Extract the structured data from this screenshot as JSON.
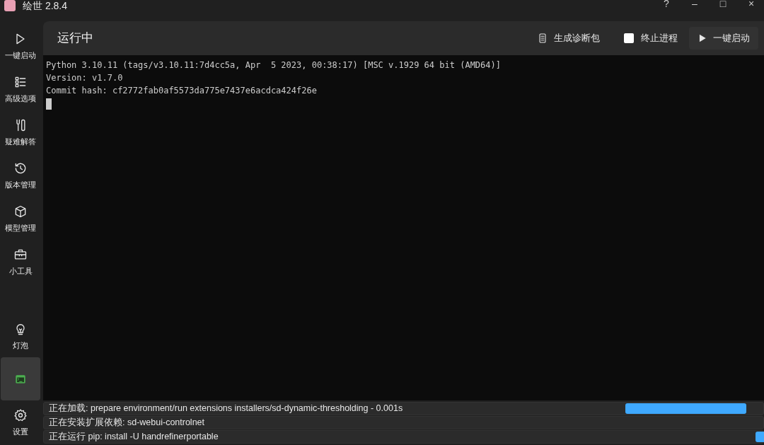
{
  "window": {
    "title": "绘世 2.8.4",
    "controls": [
      "?",
      "–",
      "□",
      "×"
    ]
  },
  "sidebar": {
    "items": [
      {
        "label": "一键启动",
        "kind": "play",
        "selected": false
      },
      {
        "label": "高级选项",
        "kind": "list",
        "selected": false
      },
      {
        "label": "疑难解答",
        "kind": "tools",
        "selected": false
      },
      {
        "label": "版本管理",
        "kind": "history",
        "selected": false
      },
      {
        "label": "模型管理",
        "kind": "cube",
        "selected": false
      },
      {
        "label": "小工具",
        "kind": "toolbox",
        "selected": false
      }
    ],
    "bottom_items": [
      {
        "label": "灯泡",
        "kind": "bulb",
        "selected": false
      },
      {
        "kind": "terminal",
        "selected": true
      },
      {
        "label": "设置",
        "kind": "gear",
        "selected": false
      }
    ]
  },
  "header": {
    "title": "运行中",
    "actions": [
      {
        "kind": "button",
        "label": "生成诊断包"
      },
      {
        "kind": "checkbox",
        "label": "终止进程",
        "checked": false
      },
      {
        "kind": "primary",
        "label": "一键启动"
      }
    ]
  },
  "console": {
    "lines": [
      "Python 3.10.11 (tags/v3.10.11:7d4cc5a, Apr  5 2023, 00:38:17) [MSC v.1929 64 bit (AMD64)]",
      "Version: v1.7.0",
      "Commit hash: cf2772fab0af5573da775e7437e6acdca424f26e"
    ],
    "cursor": true
  },
  "status_rows": [
    {
      "text": "正在加载: prepare environment/run extensions installers/sd-dynamic-thresholding - 0.001s",
      "busy": true
    },
    {
      "text": "正在安装扩展依赖: sd-webui-controlnet",
      "busy": false
    },
    {
      "text": "正在运行 pip: install -U handrefinerportable",
      "busy": true
    }
  ]
}
